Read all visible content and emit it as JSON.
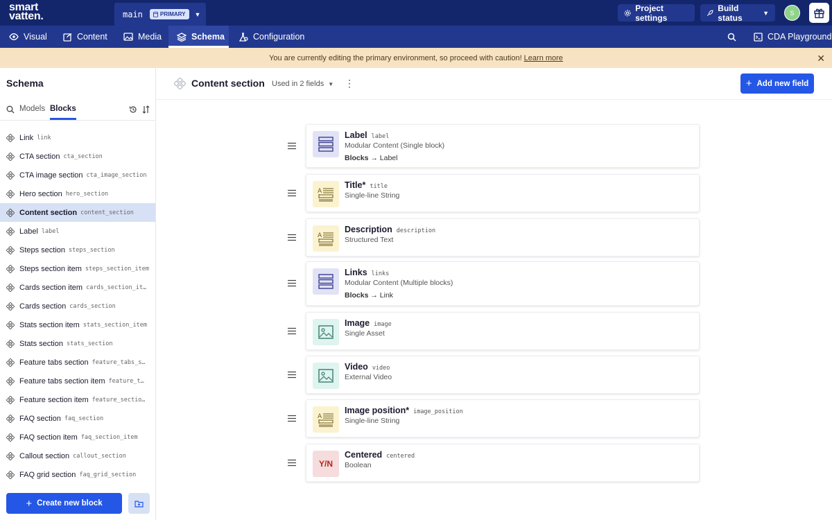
{
  "topbar": {
    "logo_line1": "smart",
    "logo_line2": "vatten.",
    "environment": "main",
    "environment_badge": "PRIMARY",
    "project_settings": "Project settings",
    "build_status": "Build status",
    "avatar_initial": "S"
  },
  "nav": {
    "visual": "Visual",
    "content": "Content",
    "media": "Media",
    "schema": "Schema",
    "configuration": "Configuration",
    "cda_playground": "CDA Playground"
  },
  "banner": {
    "message": "You are currently editing the primary environment, so proceed with caution!",
    "link": "Learn more"
  },
  "sidebar": {
    "title": "Schema",
    "tab_models": "Models",
    "tab_blocks": "Blocks",
    "items": [
      {
        "name": "Link",
        "api": "link"
      },
      {
        "name": "CTA section",
        "api": "cta_section"
      },
      {
        "name": "CTA image section",
        "api": "cta_image_section"
      },
      {
        "name": "Hero section",
        "api": "hero_section"
      },
      {
        "name": "Content section",
        "api": "content_section"
      },
      {
        "name": "Label",
        "api": "label"
      },
      {
        "name": "Steps section",
        "api": "steps_section"
      },
      {
        "name": "Steps section item",
        "api": "steps_section_item"
      },
      {
        "name": "Cards section item",
        "api": "cards_section_it…"
      },
      {
        "name": "Cards section",
        "api": "cards_section"
      },
      {
        "name": "Stats section item",
        "api": "stats_section_item"
      },
      {
        "name": "Stats section",
        "api": "stats_section"
      },
      {
        "name": "Feature tabs section",
        "api": "feature_tabs_s…"
      },
      {
        "name": "Feature tabs section item",
        "api": "feature_t…"
      },
      {
        "name": "Feature section item",
        "api": "feature_sectio…"
      },
      {
        "name": "FAQ section",
        "api": "faq_section"
      },
      {
        "name": "FAQ section item",
        "api": "faq_section_item"
      },
      {
        "name": "Callout section",
        "api": "callout_section"
      },
      {
        "name": "FAQ grid section",
        "api": "faq_grid_section"
      }
    ],
    "active_index": 4,
    "create_button": "Create new block"
  },
  "main": {
    "title": "Content section",
    "used_in": "Used in 2 fields",
    "add_button": "Add new field",
    "fields": [
      {
        "name": "Label",
        "api": "label",
        "type": "Modular Content (Single block)",
        "sub_label": "Blocks",
        "sub_value": "→ Label",
        "icon": "modular-icon"
      },
      {
        "name": "Title*",
        "api": "title",
        "type": "Single-line String",
        "icon": "string-icon"
      },
      {
        "name": "Description",
        "api": "description",
        "type": "Structured Text",
        "icon": "string-icon"
      },
      {
        "name": "Links",
        "api": "links",
        "type": "Modular Content (Multiple blocks)",
        "sub_label": "Blocks",
        "sub_value": "→ Link",
        "icon": "modular-icon"
      },
      {
        "name": "Image",
        "api": "image",
        "type": "Single Asset",
        "icon": "image-icon"
      },
      {
        "name": "Video",
        "api": "video",
        "type": "External Video",
        "icon": "image-icon"
      },
      {
        "name": "Image position*",
        "api": "image_position",
        "type": "Single-line String",
        "icon": "string-icon"
      },
      {
        "name": "Centered",
        "api": "centered",
        "type": "Boolean",
        "icon": "boolean-icon",
        "tile_text": "Y/N"
      }
    ]
  },
  "colors": {
    "topbar": "#13266c",
    "navbar": "#22388e",
    "accent": "#2457e6",
    "banner": "#f7e3c2",
    "active_item": "#d7e1f5"
  }
}
